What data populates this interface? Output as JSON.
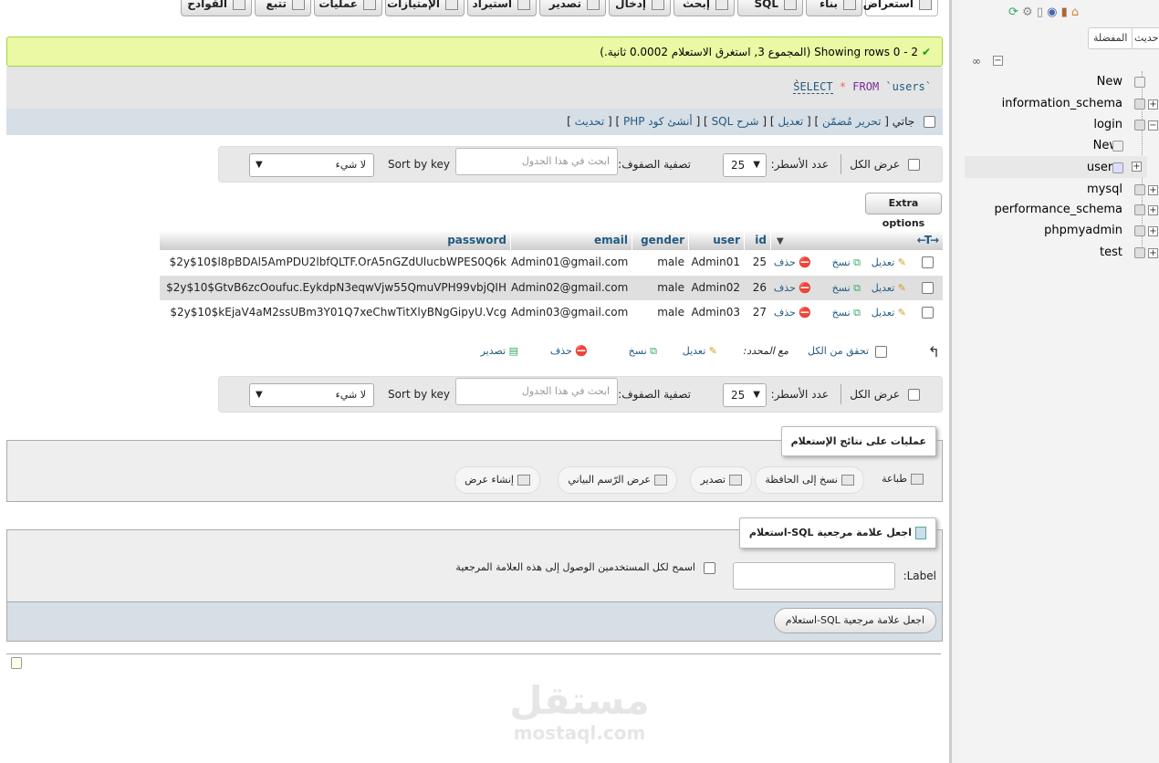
{
  "tabs": [
    {
      "label": "استعراض",
      "active": true,
      "icon": "browse-icon"
    },
    {
      "label": "بناء",
      "active": false,
      "icon": "structure-icon"
    },
    {
      "label": "SQL",
      "active": false,
      "icon": "sql-icon"
    },
    {
      "label": "إبحث",
      "active": false,
      "icon": "search-icon"
    },
    {
      "label": "إدخال",
      "active": false,
      "icon": "insert-icon"
    },
    {
      "label": "تصدير",
      "active": false,
      "icon": "export-icon"
    },
    {
      "label": "استيراد",
      "active": false,
      "icon": "import-icon"
    },
    {
      "label": "الإمتيازات",
      "active": false,
      "icon": "privileges-icon"
    },
    {
      "label": "عمليات",
      "active": false,
      "icon": "operations-icon"
    },
    {
      "label": "تتبع",
      "active": false,
      "icon": "tracking-icon"
    },
    {
      "label": "القوادح",
      "active": false,
      "icon": "triggers-icon"
    }
  ],
  "message": {
    "text": "Showing rows 0 - 2 (المجموع 3, استغرق الاستعلام 0.0002 ثانية.)",
    "icon": "success-check-icon"
  },
  "sql": {
    "select": "SELECT",
    "star": "*",
    "from": "FROM",
    "table": "`users`",
    "open": "`"
  },
  "sql_links": {
    "inline": "جاتي",
    "inline_edit": "تحرير مُضمّن",
    "edit": "تعديل",
    "explain": "شرح SQL",
    "php": "أنشئ كود PHP",
    "refresh": "تحديث"
  },
  "nav_bar": {
    "show_all": "عرض الكل",
    "rows_label": "عدد الأسطر:",
    "rows_value": "25",
    "filter_label": "تصفية الصفوف:",
    "filter_placeholder": "ابحث في هذا الجدول",
    "sort_label": "Sort by key",
    "sort_value": "لا شيء"
  },
  "extra_options": "Extra options",
  "table": {
    "headers": [
      "id",
      "user",
      "gender",
      "email",
      "password"
    ],
    "actions": {
      "edit": "تعديل",
      "copy": "نسخ",
      "delete": "حذف"
    },
    "rows": [
      {
        "id": "25",
        "user": "Admin01",
        "gender": "male",
        "email": "Admin01@gmail.com",
        "password": "$2y$10$l8pBDAl5AmPDU2lbfQLTF.OrA5nGZdUlucbWPES0Q6k"
      },
      {
        "id": "26",
        "user": "Admin02",
        "gender": "male",
        "email": "Admin02@gmail.com",
        "password": "$2y$10$GtvB6zcOoufuc.EykdpN3eqwVjw55QmuVPH99vbjQIH"
      },
      {
        "id": "27",
        "user": "Admin03",
        "gender": "male",
        "email": "Admin03@gmail.com",
        "password": "$2y$10$kEjaV4aM2ssUBm3Y01Q7xeChwTitXlyBNgGipyU.Vcg"
      }
    ]
  },
  "with_selected": {
    "check_all": "تحقق من الكل",
    "label": "مع المحدد:",
    "edit": "تعديل",
    "copy": "نسخ",
    "delete": "حذف",
    "export": "تصدير"
  },
  "query_ops": {
    "legend": "عمليات على نتائج الإستعلام",
    "print": "طباعة",
    "copy_clipboard": "نسخ إلى الحافظة",
    "export": "تصدير",
    "chart": "عرض الرّسم البياني",
    "create_view": "إنشاء عرض"
  },
  "bookmark": {
    "legend": "اجعل علامة مرجعية SQL-استعلام",
    "label": "Label:",
    "share": "اسمح لكل المستخدمين الوصول إلى هذه العلامة المرجعية",
    "submit": "اجعل علامة مرجعية SQL-استعلام"
  },
  "navigation": {
    "recent": "حديث",
    "favorites": "المفضلة",
    "databases": [
      {
        "name": "New",
        "type": "new"
      },
      {
        "name": "information_schema",
        "type": "db"
      },
      {
        "name": "login",
        "type": "db-open"
      },
      {
        "name": "New",
        "type": "new-table"
      },
      {
        "name": "users",
        "type": "table"
      },
      {
        "name": "mysql",
        "type": "db"
      },
      {
        "name": "performance_schema",
        "type": "db"
      },
      {
        "name": "phpmyadmin",
        "type": "db"
      },
      {
        "name": "test",
        "type": "db"
      }
    ]
  },
  "watermark": {
    "arabic": "مستقل",
    "latin": "mostaql.com"
  },
  "colors": {
    "link": "#235a81",
    "success_bg": "#ebf8a4",
    "success_border": "#a2d246",
    "delete": "#d9534f"
  }
}
